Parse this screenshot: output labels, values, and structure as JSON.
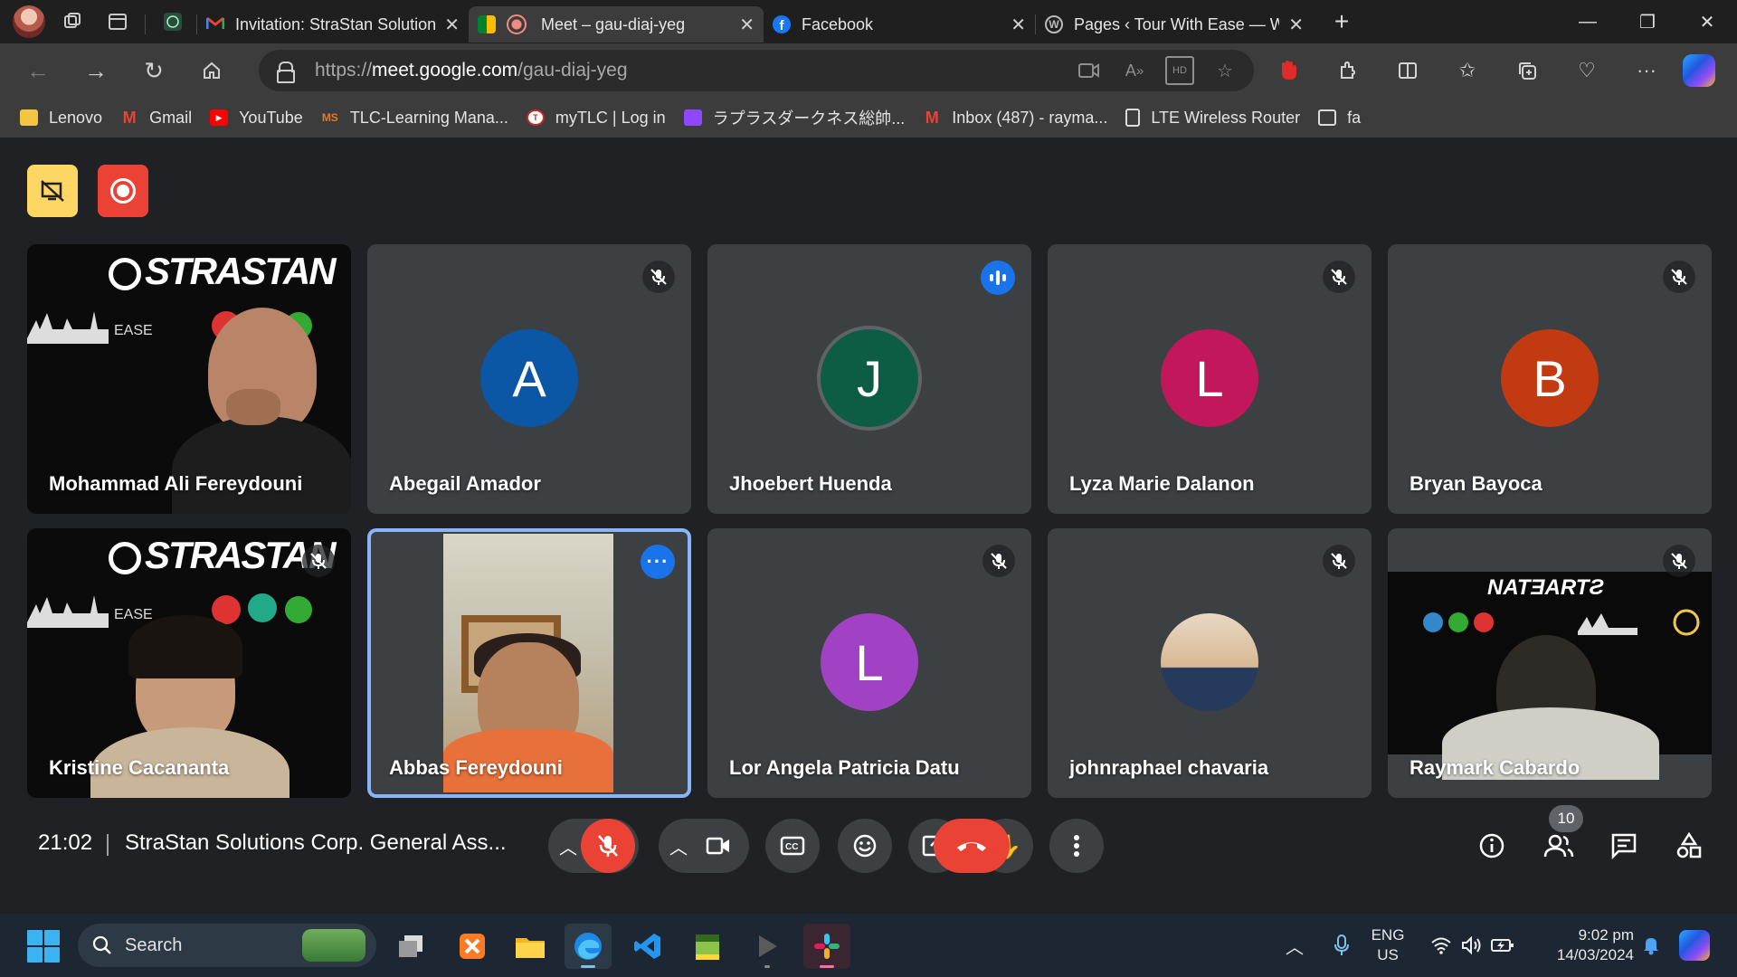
{
  "browser": {
    "tabs": [
      {
        "title": "Invitation: StraStan Solutions",
        "active": false
      },
      {
        "title": "Meet – gau-diaj-yeg",
        "active": true
      },
      {
        "title": "Facebook",
        "active": false
      },
      {
        "title": "Pages ‹ Tour With Ease — Wc",
        "active": false
      }
    ],
    "url_prefix": "https://",
    "url_host": "meet.google.com",
    "url_path": "/gau-diaj-yeg",
    "bookmarks": [
      {
        "label": "Lenovo",
        "icon": "folder-icon",
        "color": "#f4c542"
      },
      {
        "label": "Gmail",
        "icon": "gmail-icon",
        "color": "#ea4335"
      },
      {
        "label": "YouTube",
        "icon": "youtube-icon",
        "color": "#ff0000"
      },
      {
        "label": "TLC-Learning Mana...",
        "icon": "ms-icon",
        "color": "#e07b24"
      },
      {
        "label": "myTLC | Log in",
        "icon": "tlc-icon",
        "color": "#c62828"
      },
      {
        "label": "ラプラスダークネス総帥...",
        "icon": "twitch-icon",
        "color": "#9146ff"
      },
      {
        "label": "Inbox (487) - rayma...",
        "icon": "gmail-icon",
        "color": "#ea4335"
      },
      {
        "label": "LTE Wireless Router",
        "icon": "page-icon",
        "color": "#dcdcdc"
      },
      {
        "label": "fa",
        "icon": "calendar-icon",
        "color": "#dcdcdc"
      }
    ]
  },
  "meet": {
    "participants": [
      {
        "name": "Mohammad Ali Fereydouni",
        "kind": "video",
        "muted": false
      },
      {
        "name": "Abegail Amador",
        "kind": "avatar",
        "initial": "A",
        "color": "#0b57a6",
        "muted": true
      },
      {
        "name": "Jhoebert Huenda",
        "kind": "avatar",
        "initial": "J",
        "color": "#0d5c46",
        "muted": false,
        "speaking": true
      },
      {
        "name": "Lyza Marie Dalanon",
        "kind": "avatar",
        "initial": "L",
        "color": "#c2185b",
        "muted": true
      },
      {
        "name": "Bryan Bayoca",
        "kind": "avatar",
        "initial": "B",
        "color": "#c23a12",
        "muted": true
      },
      {
        "name": "Kristine Cacananta",
        "kind": "video",
        "muted": true
      },
      {
        "name": "Abbas Fereydouni",
        "kind": "video",
        "muted": false,
        "pinned": true
      },
      {
        "name": "Lor Angela Patricia Datu",
        "kind": "avatar",
        "initial": "L",
        "color": "#a142c4",
        "muted": true
      },
      {
        "name": "johnraphael chavaria",
        "kind": "photo",
        "muted": true
      },
      {
        "name": "Raymark Cabardo",
        "kind": "video",
        "muted": true
      }
    ],
    "brand_text": "STRASTAN",
    "brand_text_mirrored": "NATƎARTƧ",
    "meeting_time": "21:02",
    "meeting_title": "StraStan Solutions Corp. General Ass...",
    "people_count": "10",
    "colors": {
      "accent": "#8ab4f8",
      "danger": "#ea4335",
      "control_bg": "#3c4043"
    }
  },
  "taskbar": {
    "search_placeholder": "Search",
    "lang_line1": "ENG",
    "lang_line2": "US",
    "time": "9:02 pm",
    "date": "14/03/2024"
  }
}
